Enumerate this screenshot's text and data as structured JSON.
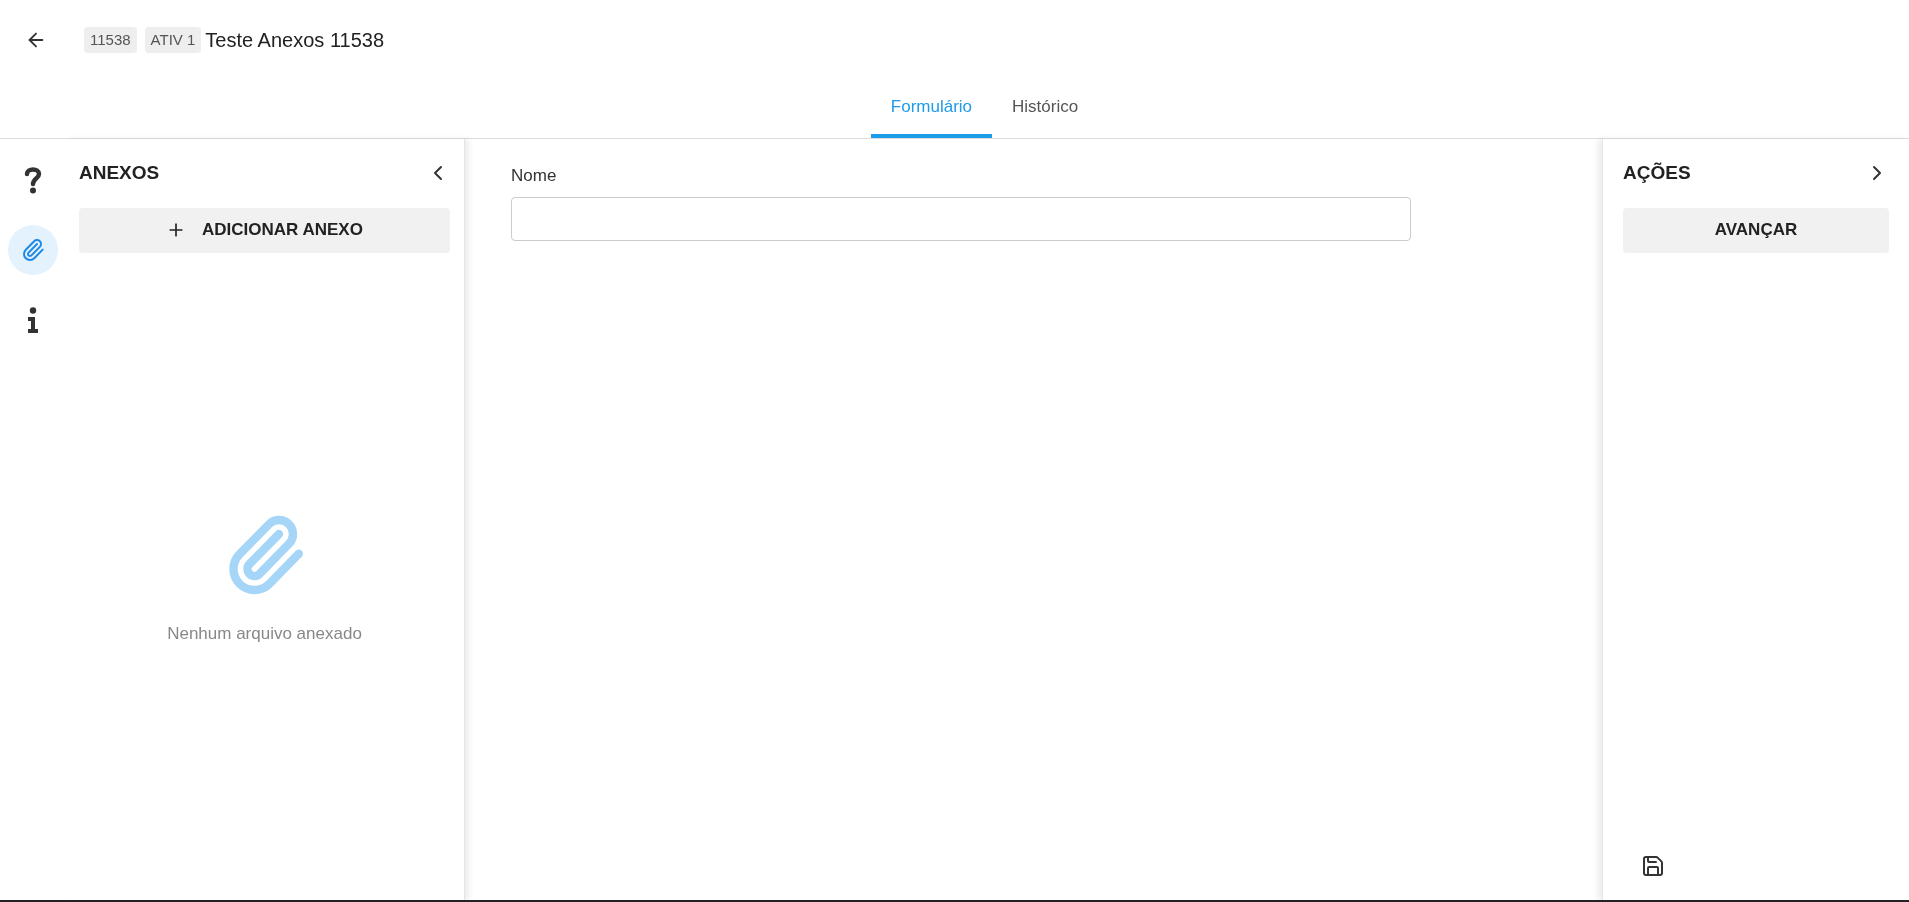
{
  "header": {
    "badges": [
      "11538",
      "ATIV 1"
    ],
    "title": "Teste Anexos 11538"
  },
  "tabs": [
    {
      "label": "Formulário",
      "selected": true
    },
    {
      "label": "Histórico",
      "selected": false
    }
  ],
  "rail": [
    {
      "kind": "help",
      "selected": false
    },
    {
      "kind": "attachment",
      "selected": true
    },
    {
      "kind": "info",
      "selected": false
    }
  ],
  "attachments_panel": {
    "title": "ANEXOS",
    "add_button": "ADICIONAR ANEXO",
    "empty_text": "Nenhum arquivo anexado"
  },
  "form": {
    "fields": [
      {
        "label": "Nome"
      }
    ]
  },
  "actions_panel": {
    "title": "AÇÕES",
    "buttons": [
      "AVANÇAR"
    ]
  }
}
